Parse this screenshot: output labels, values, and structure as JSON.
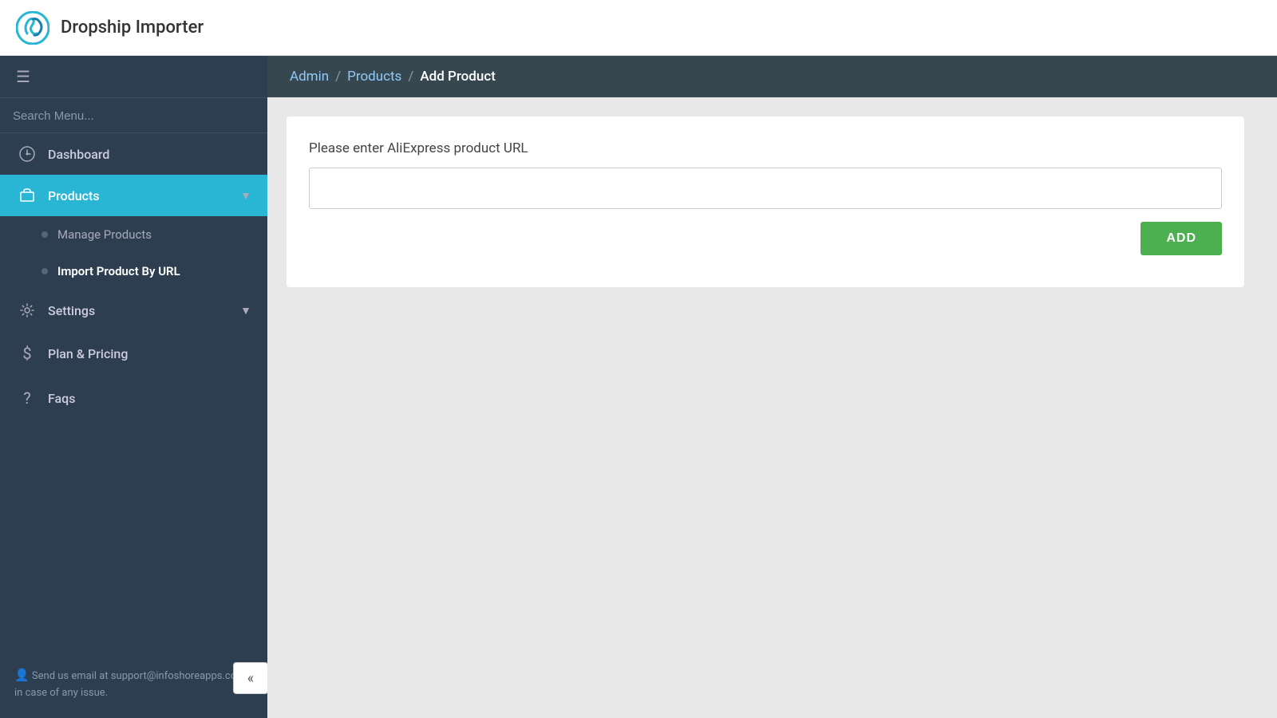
{
  "header": {
    "app_title": "Dropship Importer",
    "logo_alt": "dropship-importer-logo"
  },
  "sidebar": {
    "search_placeholder": "Search Menu...",
    "nav_items": [
      {
        "id": "dashboard",
        "label": "Dashboard",
        "icon": "dashboard",
        "active": false,
        "has_submenu": false
      },
      {
        "id": "products",
        "label": "Products",
        "icon": "products",
        "active": true,
        "has_submenu": true
      }
    ],
    "products_subitems": [
      {
        "id": "manage-products",
        "label": "Manage Products",
        "active": false
      },
      {
        "id": "import-product",
        "label": "Import Product By URL",
        "active": true
      }
    ],
    "other_items": [
      {
        "id": "settings",
        "label": "Settings",
        "icon": "settings",
        "active": false,
        "has_submenu": true
      },
      {
        "id": "plan-pricing",
        "label": "Plan & Pricing",
        "icon": "dollar",
        "active": false,
        "has_submenu": false
      },
      {
        "id": "faqs",
        "label": "Faqs",
        "icon": "question",
        "active": false,
        "has_submenu": false
      }
    ],
    "support_text": "Send us email at support@infoshoreapps.com in case of any issue.",
    "collapse_label": "«"
  },
  "breadcrumb": {
    "items": [
      {
        "label": "Admin",
        "link": true
      },
      {
        "label": "Products",
        "link": true
      },
      {
        "label": "Add Product",
        "link": false
      }
    ]
  },
  "main": {
    "card_label": "Please enter AliExpress product URL",
    "url_placeholder": "",
    "add_button_label": "ADD"
  }
}
